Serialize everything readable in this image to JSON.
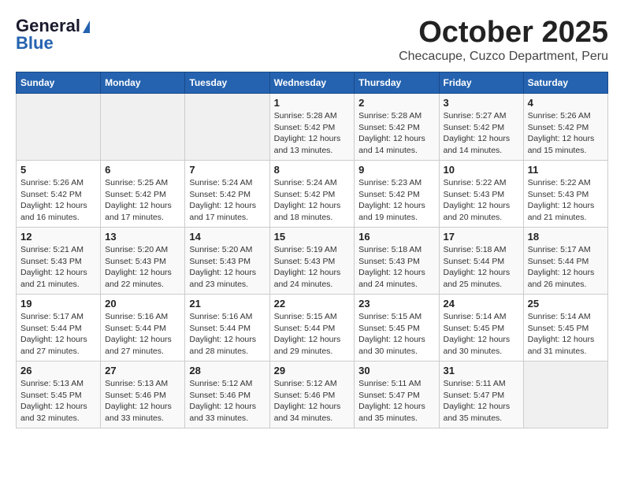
{
  "header": {
    "logo_general": "General",
    "logo_blue": "Blue",
    "month_title": "October 2025",
    "location": "Checacupe, Cuzco Department, Peru"
  },
  "days_of_week": [
    "Sunday",
    "Monday",
    "Tuesday",
    "Wednesday",
    "Thursday",
    "Friday",
    "Saturday"
  ],
  "weeks": [
    [
      {
        "day": "",
        "info": ""
      },
      {
        "day": "",
        "info": ""
      },
      {
        "day": "",
        "info": ""
      },
      {
        "day": "1",
        "info": "Sunrise: 5:28 AM\nSunset: 5:42 PM\nDaylight: 12 hours\nand 13 minutes."
      },
      {
        "day": "2",
        "info": "Sunrise: 5:28 AM\nSunset: 5:42 PM\nDaylight: 12 hours\nand 14 minutes."
      },
      {
        "day": "3",
        "info": "Sunrise: 5:27 AM\nSunset: 5:42 PM\nDaylight: 12 hours\nand 14 minutes."
      },
      {
        "day": "4",
        "info": "Sunrise: 5:26 AM\nSunset: 5:42 PM\nDaylight: 12 hours\nand 15 minutes."
      }
    ],
    [
      {
        "day": "5",
        "info": "Sunrise: 5:26 AM\nSunset: 5:42 PM\nDaylight: 12 hours\nand 16 minutes."
      },
      {
        "day": "6",
        "info": "Sunrise: 5:25 AM\nSunset: 5:42 PM\nDaylight: 12 hours\nand 17 minutes."
      },
      {
        "day": "7",
        "info": "Sunrise: 5:24 AM\nSunset: 5:42 PM\nDaylight: 12 hours\nand 17 minutes."
      },
      {
        "day": "8",
        "info": "Sunrise: 5:24 AM\nSunset: 5:42 PM\nDaylight: 12 hours\nand 18 minutes."
      },
      {
        "day": "9",
        "info": "Sunrise: 5:23 AM\nSunset: 5:42 PM\nDaylight: 12 hours\nand 19 minutes."
      },
      {
        "day": "10",
        "info": "Sunrise: 5:22 AM\nSunset: 5:43 PM\nDaylight: 12 hours\nand 20 minutes."
      },
      {
        "day": "11",
        "info": "Sunrise: 5:22 AM\nSunset: 5:43 PM\nDaylight: 12 hours\nand 21 minutes."
      }
    ],
    [
      {
        "day": "12",
        "info": "Sunrise: 5:21 AM\nSunset: 5:43 PM\nDaylight: 12 hours\nand 21 minutes."
      },
      {
        "day": "13",
        "info": "Sunrise: 5:20 AM\nSunset: 5:43 PM\nDaylight: 12 hours\nand 22 minutes."
      },
      {
        "day": "14",
        "info": "Sunrise: 5:20 AM\nSunset: 5:43 PM\nDaylight: 12 hours\nand 23 minutes."
      },
      {
        "day": "15",
        "info": "Sunrise: 5:19 AM\nSunset: 5:43 PM\nDaylight: 12 hours\nand 24 minutes."
      },
      {
        "day": "16",
        "info": "Sunrise: 5:18 AM\nSunset: 5:43 PM\nDaylight: 12 hours\nand 24 minutes."
      },
      {
        "day": "17",
        "info": "Sunrise: 5:18 AM\nSunset: 5:44 PM\nDaylight: 12 hours\nand 25 minutes."
      },
      {
        "day": "18",
        "info": "Sunrise: 5:17 AM\nSunset: 5:44 PM\nDaylight: 12 hours\nand 26 minutes."
      }
    ],
    [
      {
        "day": "19",
        "info": "Sunrise: 5:17 AM\nSunset: 5:44 PM\nDaylight: 12 hours\nand 27 minutes."
      },
      {
        "day": "20",
        "info": "Sunrise: 5:16 AM\nSunset: 5:44 PM\nDaylight: 12 hours\nand 27 minutes."
      },
      {
        "day": "21",
        "info": "Sunrise: 5:16 AM\nSunset: 5:44 PM\nDaylight: 12 hours\nand 28 minutes."
      },
      {
        "day": "22",
        "info": "Sunrise: 5:15 AM\nSunset: 5:44 PM\nDaylight: 12 hours\nand 29 minutes."
      },
      {
        "day": "23",
        "info": "Sunrise: 5:15 AM\nSunset: 5:45 PM\nDaylight: 12 hours\nand 30 minutes."
      },
      {
        "day": "24",
        "info": "Sunrise: 5:14 AM\nSunset: 5:45 PM\nDaylight: 12 hours\nand 30 minutes."
      },
      {
        "day": "25",
        "info": "Sunrise: 5:14 AM\nSunset: 5:45 PM\nDaylight: 12 hours\nand 31 minutes."
      }
    ],
    [
      {
        "day": "26",
        "info": "Sunrise: 5:13 AM\nSunset: 5:45 PM\nDaylight: 12 hours\nand 32 minutes."
      },
      {
        "day": "27",
        "info": "Sunrise: 5:13 AM\nSunset: 5:46 PM\nDaylight: 12 hours\nand 33 minutes."
      },
      {
        "day": "28",
        "info": "Sunrise: 5:12 AM\nSunset: 5:46 PM\nDaylight: 12 hours\nand 33 minutes."
      },
      {
        "day": "29",
        "info": "Sunrise: 5:12 AM\nSunset: 5:46 PM\nDaylight: 12 hours\nand 34 minutes."
      },
      {
        "day": "30",
        "info": "Sunrise: 5:11 AM\nSunset: 5:47 PM\nDaylight: 12 hours\nand 35 minutes."
      },
      {
        "day": "31",
        "info": "Sunrise: 5:11 AM\nSunset: 5:47 PM\nDaylight: 12 hours\nand 35 minutes."
      },
      {
        "day": "",
        "info": ""
      }
    ]
  ]
}
